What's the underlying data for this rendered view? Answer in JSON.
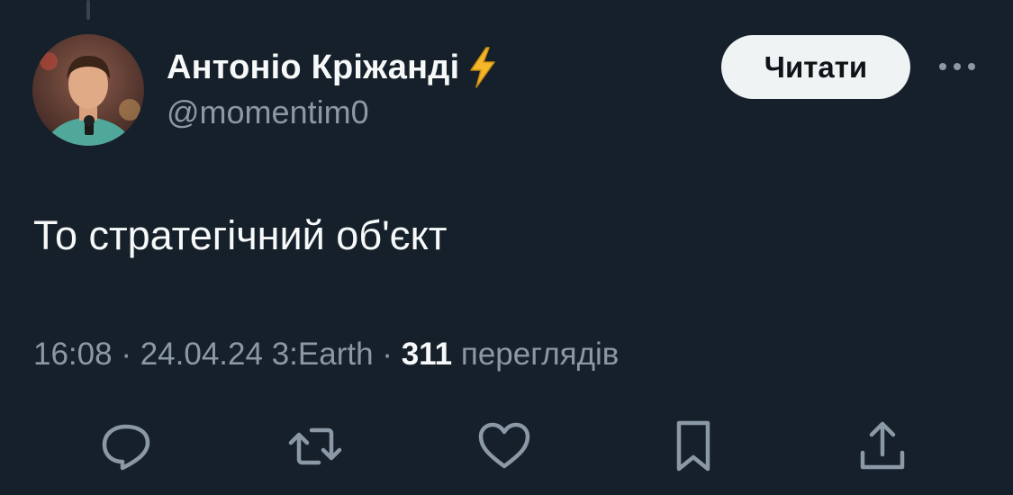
{
  "tweet": {
    "author": {
      "display_name": "Антоніо Кріжанді",
      "handle": "@momentim0",
      "badge_icon": "lightning-bolt-icon"
    },
    "follow_label": "Читати",
    "more_icon": "more-horizontal-icon",
    "text": "То стратегічний об'єкт",
    "meta": {
      "time": "16:08",
      "date": "24.04.24",
      "source": "3:Earth",
      "separator": "·",
      "views_count": "311",
      "views_label": "переглядів"
    },
    "actions": [
      {
        "icon": "reply-icon"
      },
      {
        "icon": "retweet-icon"
      },
      {
        "icon": "like-icon"
      },
      {
        "icon": "bookmark-icon"
      },
      {
        "icon": "share-icon"
      }
    ]
  },
  "colors": {
    "background": "#15202b",
    "text_primary": "#f7f9f9",
    "text_secondary": "#8b98a5",
    "button_bg": "#eff3f4"
  }
}
